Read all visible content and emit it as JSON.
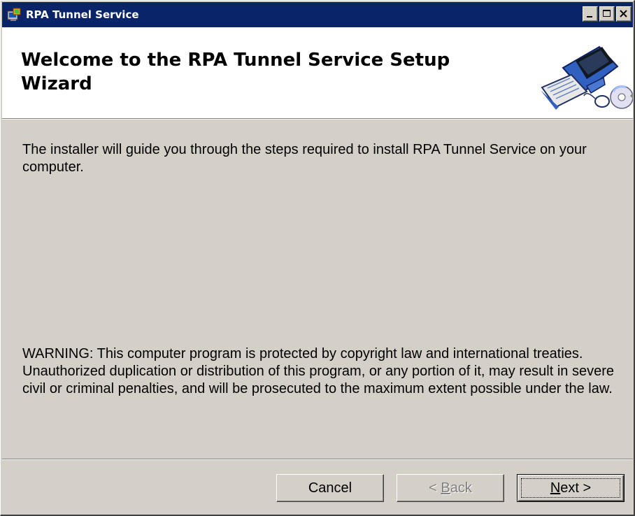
{
  "window": {
    "title": "RPA Tunnel Service",
    "icon": "installer-icon",
    "controls": {
      "minimize": "minimize-icon",
      "maximize": "maximize-icon",
      "close": "close-icon"
    }
  },
  "header": {
    "title": "Welcome to the RPA Tunnel Service Setup Wizard",
    "graphic": "computer-cd-icon"
  },
  "body": {
    "intro": "The installer will guide you through the steps required to install RPA Tunnel Service on your computer.",
    "warning": "WARNING: This computer program is protected by copyright law and international treaties. Unauthorized duplication or distribution of this program, or any portion of it, may result in severe civil or criminal penalties, and will be prosecuted to the maximum extent possible under the law."
  },
  "buttons": {
    "cancel": "Cancel",
    "back_prefix": "< ",
    "back_mnemonic": "B",
    "back_rest": "ack",
    "back_enabled": false,
    "next_mnemonic": "N",
    "next_rest": "ext >"
  },
  "colors": {
    "titlebar": "#0a246a",
    "face": "#d4d0c8",
    "header_bg": "#ffffff"
  }
}
